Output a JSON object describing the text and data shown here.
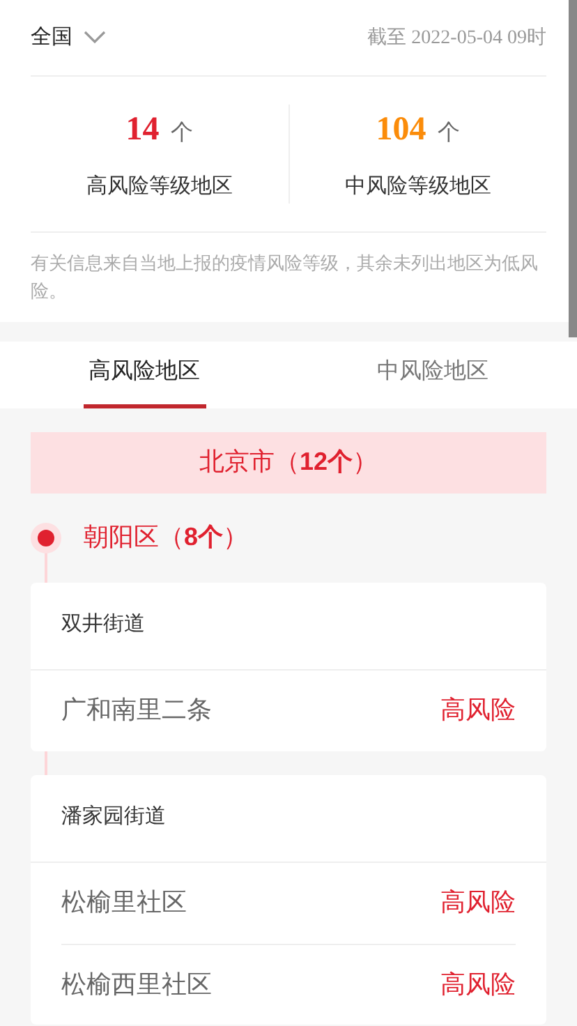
{
  "header": {
    "region": "全国",
    "updated": "截至 2022-05-04 09时"
  },
  "stats": [
    {
      "count": "14",
      "unit": "个",
      "label": "高风险等级地区",
      "color": "#e0212f"
    },
    {
      "count": "104",
      "unit": "个",
      "label": "中风险等级地区",
      "color": "#fb8c0a"
    }
  ],
  "note": "有关信息来自当地上报的疫情风险等级，其余未列出地区为低风险。",
  "tabs": [
    {
      "label": "高风险地区",
      "selected": true
    },
    {
      "label": "中风险地区",
      "selected": false
    }
  ],
  "city": "北京市（**12个**）",
  "district": "朝阳区（**8个**）",
  "streets": [
    {
      "name": "双井街道",
      "places": [
        {
          "name": "广和南里二条",
          "risk": "高风险",
          "kind": "high"
        }
      ]
    },
    {
      "name": "潘家园街道",
      "places": [
        {
          "name": "松榆里社区",
          "risk": "高风险",
          "kind": "high"
        },
        {
          "name": "松榆西里社区",
          "risk": "高风险",
          "kind": "high"
        }
      ]
    }
  ]
}
